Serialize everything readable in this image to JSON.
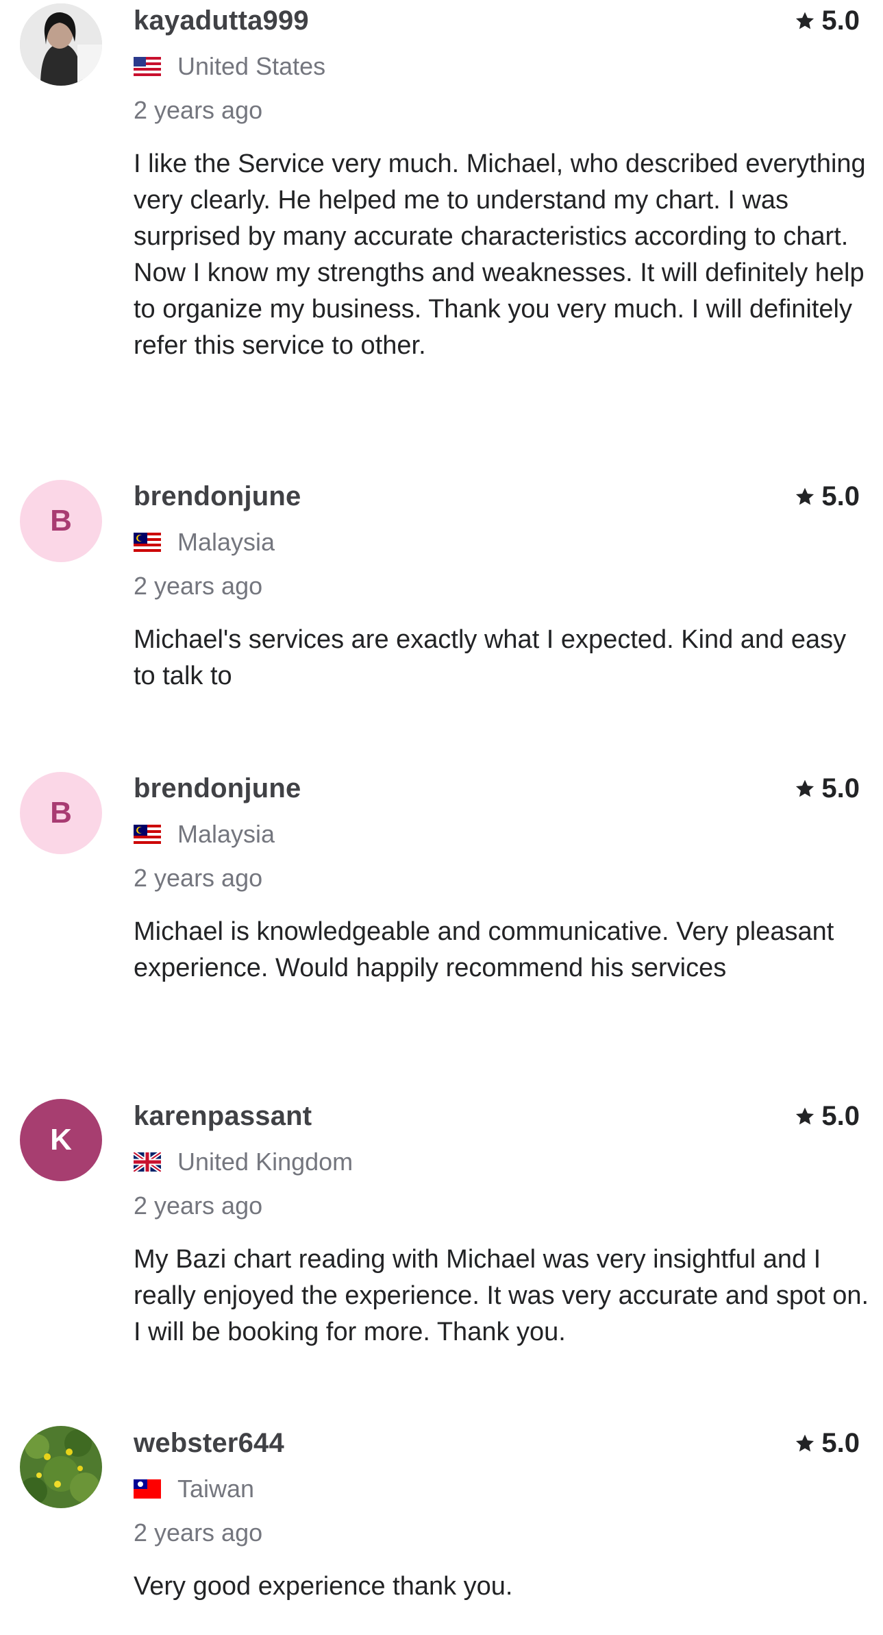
{
  "reviews": [
    {
      "username": "kayadutta999",
      "country": "United States",
      "country_flag": "us-flag-icon",
      "time": "2 years ago",
      "rating": "5.0",
      "avatar": "photo-avatar",
      "text": "I like the Service very much. Michael, who described everything very clearly. He helped me to understand my chart. I was surprised by many accurate characteristics according to chart. Now I know my strengths and weaknesses. It will definitely help to organize my business. Thank you very much. I will definitely refer this service to other."
    },
    {
      "username": "brendonjune",
      "country": "Malaysia",
      "country_flag": "my-flag-icon",
      "time": "2 years ago",
      "rating": "5.0",
      "avatar_letter": "B",
      "text": "Michael's services are exactly what I expected. Kind and easy to talk to"
    },
    {
      "username": "brendonjune",
      "country": "Malaysia",
      "country_flag": "my-flag-icon",
      "time": "2 years ago",
      "rating": "5.0",
      "avatar_letter": "B",
      "text": "Michael is knowledgeable and communicative. Very pleasant experience. Would happily recommend his services"
    },
    {
      "username": "karenpassant",
      "country": "United Kingdom",
      "country_flag": "uk-flag-icon",
      "time": "2 years ago",
      "rating": "5.0",
      "avatar_letter": "K",
      "text": "My Bazi chart reading with Michael was very insightful and I really enjoyed the experience. It was very accurate and spot on. I will be booking for more. Thank you."
    },
    {
      "username": "webster644",
      "country": "Taiwan",
      "country_flag": "tw-flag-icon",
      "time": "2 years ago",
      "rating": "5.0",
      "avatar": "photo-avatar",
      "text": "Very good experience thank you."
    }
  ],
  "colors": {
    "username": "#404145",
    "muted": "#74767e",
    "body_text": "#222325",
    "avatar_light_bg": "#fbd7e7",
    "avatar_light_fg": "#a83b72",
    "avatar_dark_bg": "#a73e70"
  }
}
